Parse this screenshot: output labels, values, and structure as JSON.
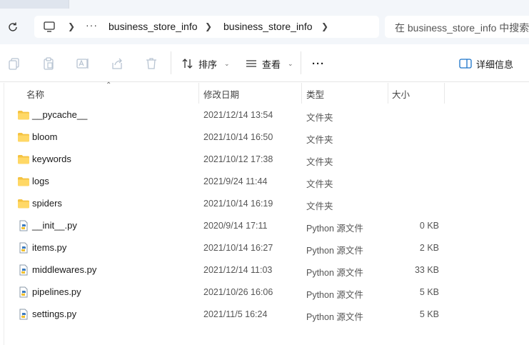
{
  "address": {
    "breadcrumbs": [
      "business_store_info",
      "business_store_info"
    ],
    "more": "···",
    "search_placeholder": "在 business_store_info 中搜索"
  },
  "toolbar": {
    "sort_label": "排序",
    "view_label": "查看",
    "more_label": "···",
    "details_label": "详细信息"
  },
  "columns": {
    "name": "名称",
    "modified": "修改日期",
    "type": "类型",
    "size": "大小"
  },
  "files": [
    {
      "name": "__pycache__",
      "modified": "2021/12/14 13:54",
      "type": "文件夹",
      "size": "",
      "icon": "folder-icon"
    },
    {
      "name": "bloom",
      "modified": "2021/10/14 16:50",
      "type": "文件夹",
      "size": "",
      "icon": "folder-icon"
    },
    {
      "name": "keywords",
      "modified": "2021/10/12 17:38",
      "type": "文件夹",
      "size": "",
      "icon": "folder-icon"
    },
    {
      "name": "logs",
      "modified": "2021/9/24 11:44",
      "type": "文件夹",
      "size": "",
      "icon": "folder-icon"
    },
    {
      "name": "spiders",
      "modified": "2021/10/14 16:19",
      "type": "文件夹",
      "size": "",
      "icon": "folder-icon"
    },
    {
      "name": "__init__.py",
      "modified": "2020/9/14 17:11",
      "type": "Python 源文件",
      "size": "0 KB",
      "icon": "python-file-icon"
    },
    {
      "name": "items.py",
      "modified": "2021/10/14 16:27",
      "type": "Python 源文件",
      "size": "2 KB",
      "icon": "python-file-icon"
    },
    {
      "name": "middlewares.py",
      "modified": "2021/12/14 11:03",
      "type": "Python 源文件",
      "size": "33 KB",
      "icon": "python-file-icon"
    },
    {
      "name": "pipelines.py",
      "modified": "2021/10/26 16:06",
      "type": "Python 源文件",
      "size": "5 KB",
      "icon": "python-file-icon"
    },
    {
      "name": "settings.py",
      "modified": "2021/11/5 16:24",
      "type": "Python 源文件",
      "size": "5 KB",
      "icon": "python-file-icon"
    }
  ],
  "colors": {
    "folder": "#f5c342",
    "accent": "#1a73c9",
    "chrome_bg": "#f3f6fa"
  }
}
